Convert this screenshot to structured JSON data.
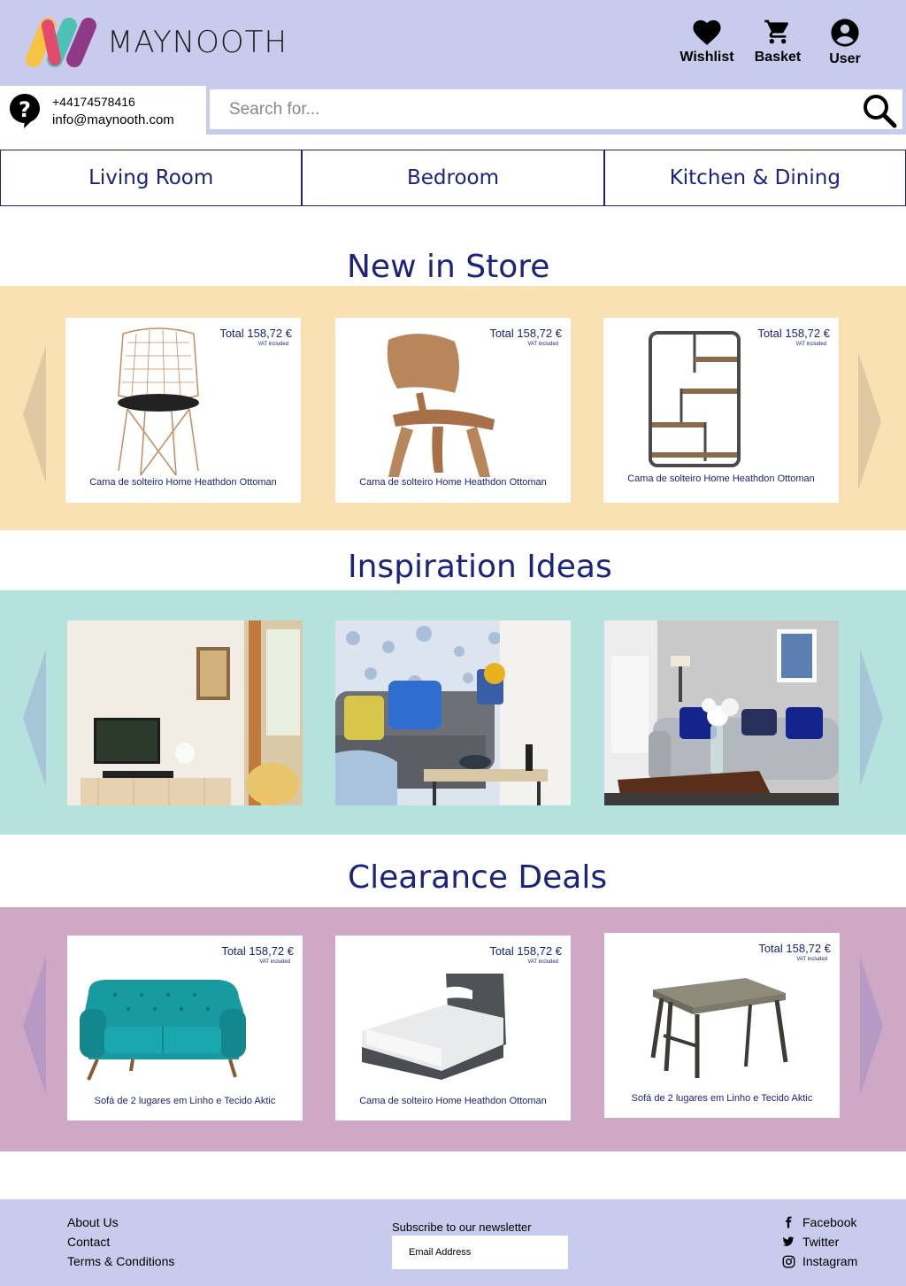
{
  "header": {
    "brand": "MAYNOOTH",
    "wishlist_label": "Wishlist",
    "basket_label": "Basket",
    "user_label": "User"
  },
  "contact": {
    "phone": "+44174578416",
    "email": "info@maynooth.com"
  },
  "search": {
    "placeholder": "Search for..."
  },
  "nav": {
    "items": [
      {
        "label": "Living Room"
      },
      {
        "label": "Bedroom"
      },
      {
        "label": "Kitchen & Dining"
      }
    ]
  },
  "new_in_store": {
    "title": "New in Store",
    "products": [
      {
        "price": "Total 158,72 €",
        "vat": "VAT included",
        "name": "Cama de solteiro Home Heathdon Ottoman",
        "icon": "wire-chair"
      },
      {
        "price": "Total 158,72 €",
        "vat": "VAT included",
        "name": "Cama de solteiro Home Heathdon Ottoman",
        "icon": "plywood-chair"
      },
      {
        "price": "Total 158,72 €",
        "vat": "VAT included",
        "name": "Cama de solteiro Home Heathdon Ottoman",
        "icon": "wall-shelf"
      }
    ]
  },
  "inspiration": {
    "title": "Inspiration Ideas",
    "photos": [
      "living-room-tv-photo",
      "blue-sofa-photo",
      "grey-sofa-photo"
    ]
  },
  "clearance": {
    "title": "Clearance Deals",
    "products": [
      {
        "price": "Total 158,72 €",
        "vat": "VAT included",
        "name": "Sofá de 2 lugares em Linho e Tecido Aktic",
        "icon": "teal-sofa"
      },
      {
        "price": "Total 158,72 €",
        "vat": "VAT included",
        "name": "Cama de solteiro Home Heathdon Ottoman",
        "icon": "single-bed"
      },
      {
        "price": "Total 158,72 €",
        "vat": "VAT included",
        "name": "Sofá de 2 lugares em Linho e Tecido Aktic",
        "icon": "dining-table"
      }
    ]
  },
  "footer": {
    "links": [
      {
        "label": "About Us"
      },
      {
        "label": "Contact"
      },
      {
        "label": "Terms & Conditions"
      }
    ],
    "newsletter_label": "Subscribe to our newsletter",
    "email_placeholder": "Email Address",
    "social": [
      {
        "label": "Facebook",
        "icon": "facebook-icon"
      },
      {
        "label": "Twitter",
        "icon": "twitter-icon"
      },
      {
        "label": "Instagram",
        "icon": "instagram-icon"
      }
    ]
  },
  "colors": {
    "header_bg": "#c8cbeb",
    "accent_text": "#1a237e",
    "new_band": "#f9e1b3",
    "inspiration_band": "#b6e2de",
    "clearance_band": "#cfa8c6"
  }
}
